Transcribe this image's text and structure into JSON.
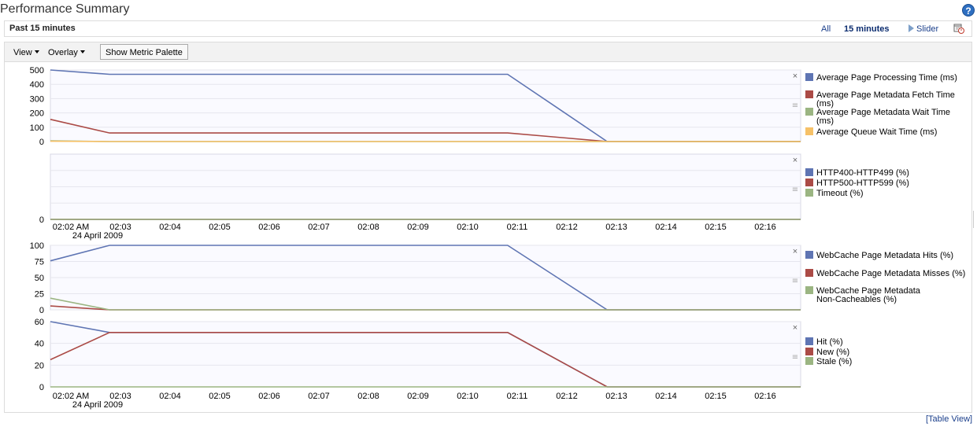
{
  "header": {
    "title": "Performance Summary",
    "help_icon": "help-icon"
  },
  "time_range": {
    "label": "Past 15 minutes",
    "options": [
      "All",
      "15 minutes",
      "Slider"
    ],
    "selected": "15 minutes",
    "calendar_icon": "calendar-clock-icon"
  },
  "toolbar": {
    "view_label": "View",
    "overlay_label": "Overlay",
    "palette_label": "Show Metric Palette"
  },
  "footer": {
    "table_view_label": "[Table View]"
  },
  "colors": {
    "blue": "#5f75b3",
    "red": "#ab4b46",
    "green": "#9bb582",
    "orange": "#f6c167",
    "link": "#1b3f8b"
  },
  "chart_data": [
    {
      "type": "line",
      "x": [
        "02:02 AM",
        "02:03",
        "02:04",
        "02:05",
        "02:06",
        "02:07",
        "02:08",
        "02:09",
        "02:10",
        "02:11",
        "02:12",
        "02:13"
      ],
      "x_tick_labels": [
        "02:02 AM",
        "02:03",
        "02:04",
        "02:05",
        "02:06",
        "02:07",
        "02:08",
        "02:09",
        "02:10",
        "02:11",
        "02:12",
        "02:13",
        "02:14",
        "02:15",
        "02:16"
      ],
      "ylim": [
        0,
        500
      ],
      "y_ticks": [
        0,
        100,
        200,
        300,
        400,
        500
      ],
      "grid": true,
      "legend_position": "right",
      "series": [
        {
          "name": "Average Page Processing Time (ms)",
          "color": "#5f75b3",
          "values": [
            500,
            470,
            470,
            470,
            470,
            470,
            470,
            470,
            470,
            470,
            235,
            0
          ]
        },
        {
          "name": "Average Page Metadata Fetch Time (ms)",
          "color": "#ab4b46",
          "values": [
            155,
            60,
            60,
            60,
            60,
            60,
            60,
            60,
            60,
            60,
            30,
            0
          ]
        },
        {
          "name": "Average Page Metadata Wait Time (ms)",
          "color": "#9bb582",
          "values": [
            5,
            0,
            0,
            0,
            0,
            0,
            0,
            0,
            0,
            0,
            0,
            0
          ]
        },
        {
          "name": "Average Queue Wait Time (ms)",
          "color": "#f6c167",
          "values": [
            2,
            0,
            0,
            0,
            0,
            0,
            0,
            0,
            0,
            0,
            0,
            0
          ]
        }
      ]
    },
    {
      "type": "line",
      "x_tick_labels": [
        "02:02 AM",
        "02:03",
        "02:04",
        "02:05",
        "02:06",
        "02:07",
        "02:08",
        "02:09",
        "02:10",
        "02:11",
        "02:12",
        "02:13",
        "02:14",
        "02:15",
        "02:16"
      ],
      "date_label": "24 April 2009",
      "y_ticks": [
        0
      ],
      "grid": true,
      "legend_position": "right",
      "series": [
        {
          "name": "HTTP400-HTTP499 (%)",
          "color": "#5f75b3",
          "values": [
            0
          ]
        },
        {
          "name": "HTTP500-HTTP599 (%)",
          "color": "#ab4b46",
          "values": [
            0
          ]
        },
        {
          "name": "Timeout (%)",
          "color": "#9bb582",
          "values": [
            0
          ]
        }
      ]
    },
    {
      "type": "line",
      "x": [
        "02:02 AM",
        "02:03",
        "02:04",
        "02:05",
        "02:06",
        "02:07",
        "02:08",
        "02:09",
        "02:10",
        "02:11",
        "02:12",
        "02:13"
      ],
      "ylim": [
        0,
        100
      ],
      "y_ticks": [
        0,
        25,
        50,
        75,
        100
      ],
      "grid": true,
      "legend_position": "right",
      "series": [
        {
          "name": "WebCache Page Metadata Hits (%)",
          "color": "#5f75b3",
          "values": [
            76,
            100,
            100,
            100,
            100,
            100,
            100,
            100,
            100,
            100,
            50,
            0
          ]
        },
        {
          "name": "WebCache Page Metadata Misses (%)",
          "color": "#ab4b46",
          "values": [
            6,
            0,
            0,
            0,
            0,
            0,
            0,
            0,
            0,
            0,
            0,
            0
          ]
        },
        {
          "name": "WebCache Page Metadata Non-Cacheables (%)",
          "color": "#9bb582",
          "values": [
            18,
            0,
            0,
            0,
            0,
            0,
            0,
            0,
            0,
            0,
            0,
            0
          ]
        }
      ]
    },
    {
      "type": "line",
      "x": [
        "02:02 AM",
        "02:03",
        "02:04",
        "02:05",
        "02:06",
        "02:07",
        "02:08",
        "02:09",
        "02:10",
        "02:11",
        "02:12",
        "02:13"
      ],
      "x_tick_labels": [
        "02:02 AM",
        "02:03",
        "02:04",
        "02:05",
        "02:06",
        "02:07",
        "02:08",
        "02:09",
        "02:10",
        "02:11",
        "02:12",
        "02:13",
        "02:14",
        "02:15",
        "02:16"
      ],
      "date_label": "24 April 2009",
      "ylim": [
        0,
        60
      ],
      "y_ticks": [
        0,
        20,
        40,
        60
      ],
      "grid": true,
      "legend_position": "right",
      "series": [
        {
          "name": "Hit (%)",
          "color": "#5f75b3",
          "values": [
            60,
            50,
            50,
            50,
            50,
            50,
            50,
            50,
            50,
            50,
            25,
            0
          ]
        },
        {
          "name": "New (%)",
          "color": "#ab4b46",
          "values": [
            25,
            50,
            50,
            50,
            50,
            50,
            50,
            50,
            50,
            50,
            25,
            0
          ]
        },
        {
          "name": "Stale (%)",
          "color": "#9bb582",
          "values": [
            0,
            0,
            0,
            0,
            0,
            0,
            0,
            0,
            0,
            0,
            0,
            0
          ]
        }
      ]
    }
  ]
}
